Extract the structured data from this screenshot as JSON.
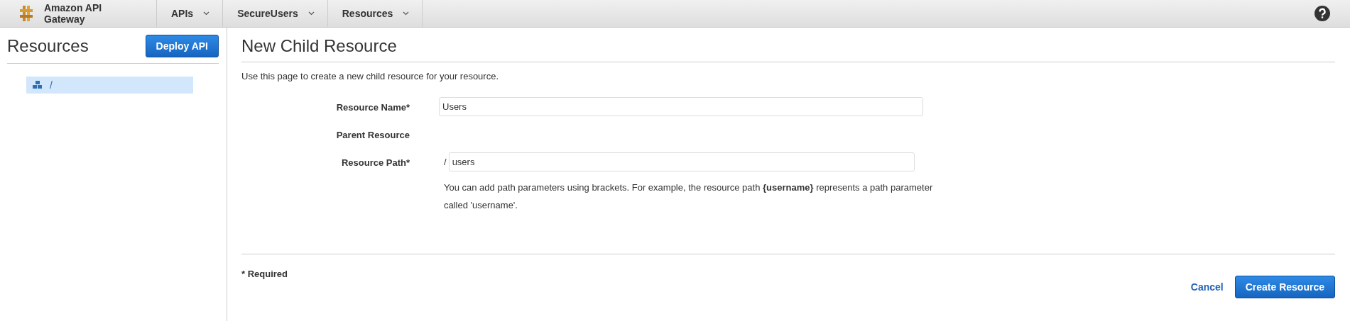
{
  "nav": {
    "brand": "Amazon API Gateway",
    "menus": [
      {
        "label": "APIs"
      },
      {
        "label": "SecureUsers"
      },
      {
        "label": "Resources"
      }
    ]
  },
  "sidebar": {
    "title": "Resources",
    "deploy_button": "Deploy API",
    "tree": [
      {
        "label": "/",
        "selected": true
      }
    ]
  },
  "main": {
    "title": "New Child Resource",
    "description": "Use this page to create a new child resource for your resource.",
    "fields": [
      {
        "kind": "input",
        "label": "Resource Name*",
        "value": "Users"
      },
      {
        "kind": "static",
        "label": "Parent Resource"
      },
      {
        "kind": "path",
        "label": "Resource Path*",
        "prefix": "/",
        "value": "users",
        "help": "You can add path parameters using brackets. For example, the resource path **{username}** represents a path parameter called 'username'."
      }
    ],
    "required_note": "* Required",
    "cancel": "Cancel",
    "submit": "Create Resource"
  }
}
